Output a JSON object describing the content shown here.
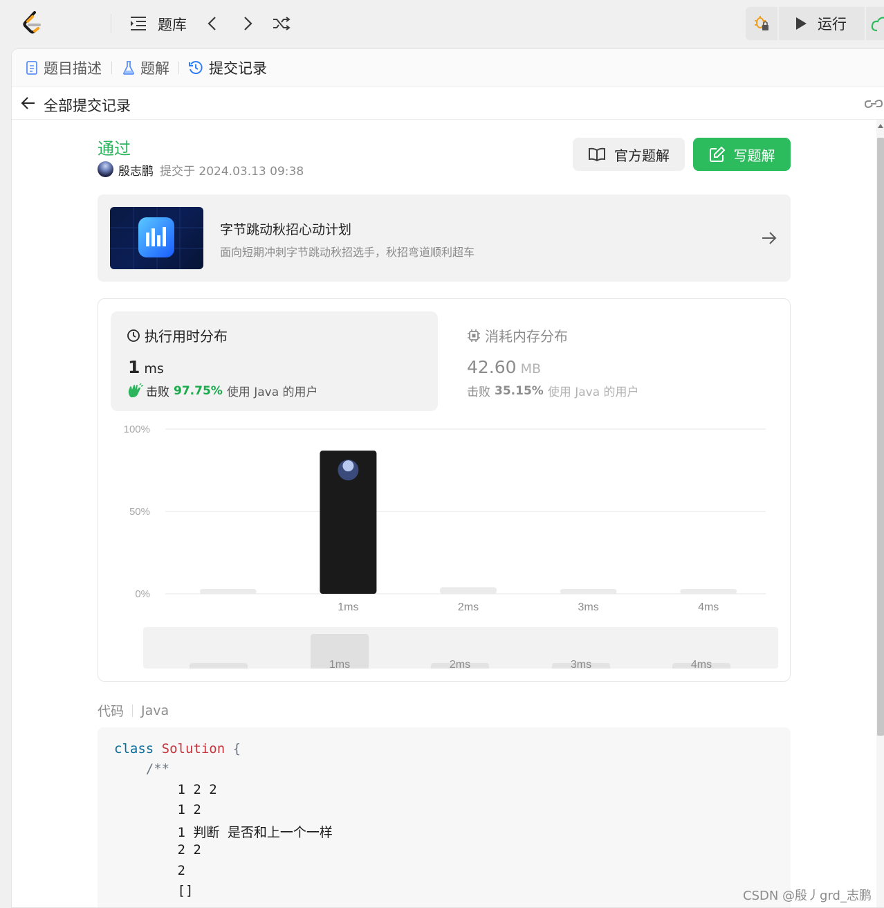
{
  "topbar": {
    "problem_list_label": "题库",
    "run_label": "运行"
  },
  "tabs": [
    {
      "label": "题目描述"
    },
    {
      "label": "题解"
    },
    {
      "label": "提交记录"
    }
  ],
  "subheader": {
    "title": "全部提交记录"
  },
  "submission": {
    "status": "通过",
    "author": "殷志鹏",
    "submitted_at": "提交于 2024.03.13 09:38",
    "official_solution_label": "官方题解",
    "write_solution_label": "写题解"
  },
  "promo": {
    "title": "字节跳动秋招心动计划",
    "description": "面向短期冲刺字节跳动秋招选手，秋招弯道顺利超车"
  },
  "runtime": {
    "title": "执行用时分布",
    "value": "1",
    "unit": "ms",
    "beat_prefix": "击败",
    "beat_percent": "97.75%",
    "beat_suffix": "使用 Java 的用户"
  },
  "memory": {
    "title": "消耗内存分布",
    "value": "42.60",
    "unit": "MB",
    "beat_prefix": "击败",
    "beat_percent": "35.15%",
    "beat_suffix": "使用 Java 的用户"
  },
  "chart_data": {
    "type": "bar",
    "categories": [
      "",
      "1ms",
      "2ms",
      "3ms",
      "4ms"
    ],
    "values": [
      1,
      86.9,
      4,
      2,
      2
    ],
    "highlight_index": 1,
    "y_ticks": [
      "100%",
      "50%",
      "0%"
    ],
    "ylim": [
      0,
      100
    ],
    "grid": true,
    "colors": {
      "highlight": "#1a1a1a",
      "normal": "#ebebeb",
      "grid": "#e6e6e6"
    }
  },
  "navigator": {
    "categories": [
      "",
      "1ms",
      "2ms",
      "3ms",
      "4ms"
    ],
    "values": [
      2,
      18,
      2,
      2,
      2
    ]
  },
  "code": {
    "label": "代码",
    "language": "Java",
    "lines": [
      {
        "kw": "class",
        "cls": "Solution",
        "rest": " {"
      },
      {
        "comment": "    /**"
      },
      {
        "text": "        1 2 2"
      },
      {
        "text": "        1 2"
      },
      {
        "text": "        1 判断 是否和上一个一样"
      },
      {
        "text": "        2 2"
      },
      {
        "text": "        2"
      },
      {
        "text": "        []"
      }
    ]
  },
  "watermark": "CSDN @殷丿grd_志鹏",
  "colors": {
    "accent_green": "#2cbb5d",
    "success_text": "#2db55d",
    "beat_green": "#1ba94c"
  }
}
